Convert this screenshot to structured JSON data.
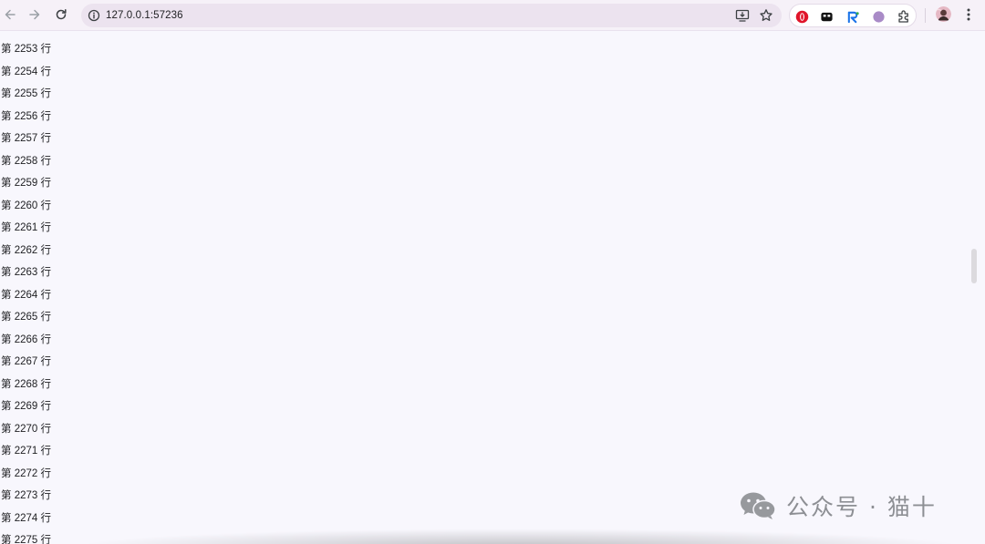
{
  "browser": {
    "url": "127.0.0.1:57236",
    "icons": {
      "back": "arrow-left-icon",
      "forward": "arrow-right-icon",
      "reload": "reload-icon",
      "site_info": "info-icon",
      "install_app": "install-app-icon",
      "bookmark": "star-icon",
      "menu": "kebab-menu-icon"
    },
    "extensions": [
      {
        "name": "opera-extension-icon",
        "color": "#e0152a"
      },
      {
        "name": "game-extension-icon",
        "color": "#111111"
      },
      {
        "name": "tool-extension-icon",
        "color": "#1a73e8"
      },
      {
        "name": "circle-extension-icon",
        "color": "#a98bc7"
      },
      {
        "name": "puzzle-extensions-icon",
        "color": "#3c4043"
      }
    ]
  },
  "content": {
    "rows": [
      "第 2253 行",
      "第 2254 行",
      "第 2255 行",
      "第 2256 行",
      "第 2257 行",
      "第 2258 行",
      "第 2259 行",
      "第 2260 行",
      "第 2261 行",
      "第 2262 行",
      "第 2263 行",
      "第 2264 行",
      "第 2265 行",
      "第 2266 行",
      "第 2267 行",
      "第 2268 行",
      "第 2269 行",
      "第 2270 行",
      "第 2271 行",
      "第 2272 行",
      "第 2273 行",
      "第 2274 行",
      "第 2275 行"
    ]
  },
  "watermark": {
    "text": "公众号 · 猫十",
    "icon": "wechat-icon"
  }
}
